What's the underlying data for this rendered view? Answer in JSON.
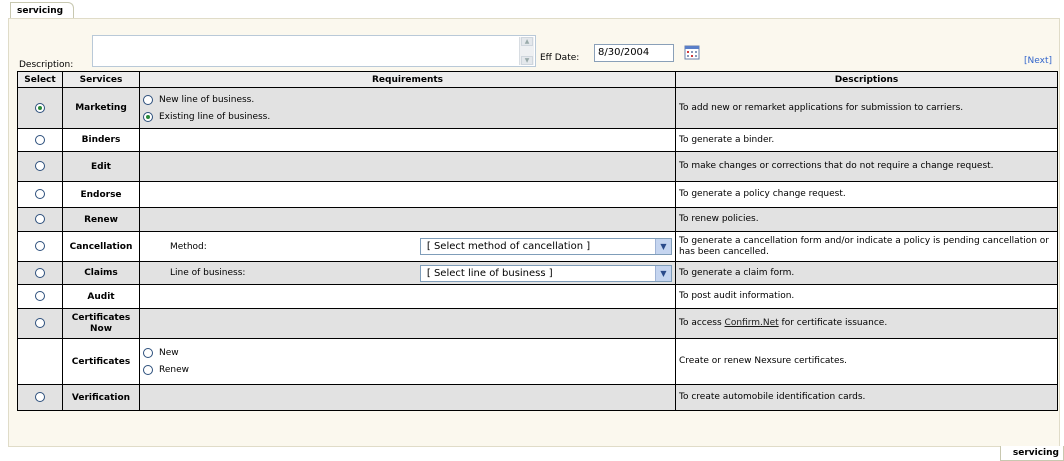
{
  "tabs": {
    "top_label": "servicing",
    "bottom_label": "servicing"
  },
  "form": {
    "description_label": "Description:",
    "description_value": "",
    "eff_date_label": "Eff Date:",
    "eff_date_value": "8/30/2004",
    "next_link": "[Next]"
  },
  "table": {
    "headers": [
      "Select",
      "Services",
      "Requirements",
      "Descriptions"
    ],
    "rows": [
      {
        "service": "Marketing",
        "selected": true,
        "options": [
          "New line of business.",
          "Existing line of business."
        ],
        "selected_option": 1,
        "description": "To add new or remarket applications for submission to carriers."
      },
      {
        "service": "Binders",
        "selected": false,
        "description": "To generate a binder."
      },
      {
        "service": "Edit",
        "selected": false,
        "description": "To make changes or corrections that do not require a change request."
      },
      {
        "service": "Endorse",
        "selected": false,
        "description": "To generate a policy change request."
      },
      {
        "service": "Renew",
        "selected": false,
        "description": "To renew policies."
      },
      {
        "service": "Cancellation",
        "selected": false,
        "req_label": "Method:",
        "req_select": "[ Select method of cancellation ]",
        "description": "To generate a cancellation form and/or indicate a policy is pending cancellation or has been cancelled."
      },
      {
        "service": "Claims",
        "selected": false,
        "req_label": "Line of business:",
        "req_select": "[ Select line of business ]",
        "description": "To generate a claim form."
      },
      {
        "service": "Audit",
        "selected": false,
        "description": "To post audit information."
      },
      {
        "service": "Certificates Now",
        "selected": false,
        "description_pre": "To access ",
        "description_link": "Confirm.Net",
        "description_post": " for certificate issuance."
      },
      {
        "service": "Certificates",
        "options": [
          "New",
          "Renew"
        ],
        "description": "Create or renew Nexsure certificates."
      },
      {
        "service": "Verification",
        "selected": false,
        "description": "To create automobile identification cards."
      }
    ]
  }
}
